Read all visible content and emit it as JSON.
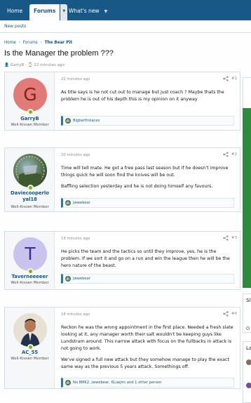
{
  "nav": {
    "home": "Home",
    "forums": "Forums",
    "whats_new": "What's new",
    "sub_new_posts": "New posts"
  },
  "breadcrumb": {
    "home": "Home",
    "forums": "Forums",
    "current": "The Bear Pit"
  },
  "thread": {
    "title": "Is the Manager the problem ???",
    "author": "GarryB",
    "time": "22 minutes ago"
  },
  "posts": [
    {
      "avatar_letter": "G",
      "avatar_color": "#e07b78",
      "username": "GarryB",
      "user_title": "Well-Known Member",
      "time": "22 minutes ago",
      "number": "#1",
      "body": [
        "As title says is he not cut out to manage but just coach ? Maybe thats the problem he is out of his depth this is my opinion on it anyway"
      ],
      "reactions": "Bigberthslaces"
    },
    {
      "avatar_letter": "",
      "username": "Daviecooperloyal18",
      "user_title": "Well-Known Member",
      "time": "20 minutes ago",
      "number": "#2",
      "body": [
        "Time will tell mate. He got a free pass last season but if he doesn't improve things quick he will soon find the knives will be out.",
        "Baffling selection yesterday and he is not doing himself any favours."
      ],
      "reactions": "jwwebear"
    },
    {
      "avatar_letter": "T",
      "avatar_color": "#c9c3ee",
      "username": "Taverneeeeer",
      "user_title": "Well-Known Member",
      "time": "19 minutes ago",
      "number": "#3",
      "body": [
        "He picks the team and the tactics so until they improve, yes, he is the problem. If we sort it and go on a run and win the league then he will be the hero nature of the beast."
      ],
      "reactions": "jwwebear"
    },
    {
      "avatar_letter": "",
      "username": "AC_55",
      "user_title": "Well-Known Member",
      "time": "18 minutes ago",
      "number": "#4",
      "body": [
        "Reckon he was the wrong appointment in the first place. Needed a fresh slate looking at it, any manager worth their salt wouldn't be keeping guys like Lundstram around. This narrow attack with focus on the fullbacks in attack is not going to work.",
        "We've signed a full new attack but they somehow manage to play the exact same way as the previous 5 years attack. Somethings off."
      ],
      "reactions": "No.8MK2, jwwebear, 6Luejim and 1 other person"
    }
  ],
  "sidebar": {
    "frag1": "Sl",
    "frag2": "La"
  },
  "colors": {
    "nav_bg": "#185886",
    "link": "#185886",
    "online": "#7fb900",
    "like": "#2577b1"
  }
}
